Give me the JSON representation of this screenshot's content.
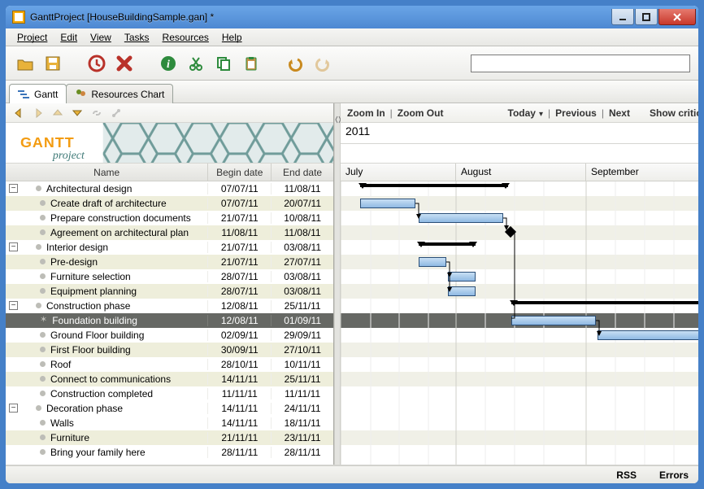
{
  "window": {
    "title": "GanttProject [HouseBuildingSample.gan] *"
  },
  "menu": {
    "project": "Project",
    "edit": "Edit",
    "view": "View",
    "tasks": "Tasks",
    "resources": "Resources",
    "help": "Help"
  },
  "tabs": {
    "gantt": "Gantt",
    "resources": "Resources Chart"
  },
  "year": "2011",
  "right_toolbar": {
    "zoom_in": "Zoom In",
    "zoom_out": "Zoom Out",
    "today": "Today",
    "previous": "Previous",
    "next": "Next",
    "show_critic": "Show critic"
  },
  "months": {
    "jul": "July",
    "aug": "August",
    "sep": "September"
  },
  "table": {
    "columns": {
      "name": "Name",
      "begin": "Begin date",
      "end": "End date"
    },
    "rows": [
      {
        "level": 0,
        "name": "Architectural design",
        "begin": "07/07/11",
        "end": "11/08/11",
        "alt": false
      },
      {
        "level": 1,
        "name": "Create draft of architecture",
        "begin": "07/07/11",
        "end": "20/07/11",
        "alt": true
      },
      {
        "level": 1,
        "name": "Prepare construction documents",
        "begin": "21/07/11",
        "end": "10/08/11",
        "alt": false
      },
      {
        "level": 1,
        "name": "Agreement on architectural plan",
        "begin": "11/08/11",
        "end": "11/08/11",
        "alt": true
      },
      {
        "level": 0,
        "name": "Interior design",
        "begin": "21/07/11",
        "end": "03/08/11",
        "alt": false
      },
      {
        "level": 1,
        "name": "Pre-design",
        "begin": "21/07/11",
        "end": "27/07/11",
        "alt": true
      },
      {
        "level": 1,
        "name": "Furniture selection",
        "begin": "28/07/11",
        "end": "03/08/11",
        "alt": false
      },
      {
        "level": 1,
        "name": "Equipment planning",
        "begin": "28/07/11",
        "end": "03/08/11",
        "alt": true
      },
      {
        "level": 0,
        "name": "Construction phase",
        "begin": "12/08/11",
        "end": "25/11/11",
        "alt": false
      },
      {
        "level": 1,
        "name": "Foundation building",
        "begin": "12/08/11",
        "end": "01/09/11",
        "alt": false,
        "sel": true
      },
      {
        "level": 1,
        "name": "Ground Floor building",
        "begin": "02/09/11",
        "end": "29/09/11",
        "alt": false
      },
      {
        "level": 1,
        "name": "First Floor building",
        "begin": "30/09/11",
        "end": "27/10/11",
        "alt": true
      },
      {
        "level": 1,
        "name": "Roof",
        "begin": "28/10/11",
        "end": "10/11/11",
        "alt": false
      },
      {
        "level": 1,
        "name": "Connect to communications",
        "begin": "14/11/11",
        "end": "25/11/11",
        "alt": true
      },
      {
        "level": 1,
        "name": "Construction completed",
        "begin": "11/11/11",
        "end": "11/11/11",
        "alt": false
      },
      {
        "level": 0,
        "name": "Decoration phase",
        "begin": "14/11/11",
        "end": "24/11/11",
        "alt": false
      },
      {
        "level": 1,
        "name": "Walls",
        "begin": "14/11/11",
        "end": "18/11/11",
        "alt": false
      },
      {
        "level": 1,
        "name": "Furniture",
        "begin": "21/11/11",
        "end": "23/11/11",
        "alt": true
      },
      {
        "level": 1,
        "name": "Bring your family here",
        "begin": "28/11/11",
        "end": "28/11/11",
        "alt": false
      }
    ]
  },
  "status": {
    "rss": "RSS",
    "errors": "Errors"
  }
}
